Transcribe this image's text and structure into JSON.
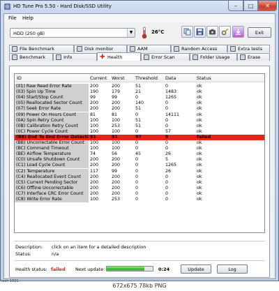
{
  "window": {
    "title": "HD Tune Pro 5.50 - Hard Disk/SSD Utility",
    "min_label": "–",
    "max_label": "□",
    "close_label": "✕"
  },
  "menu": {
    "file": "File",
    "help": "Help"
  },
  "toolbar": {
    "drive": "HDD         (250 gB)",
    "temperature": "26°C",
    "exit_label": "Exit",
    "icons": [
      "copy-icon",
      "save-icon",
      "camera-icon",
      "options-icon",
      "download-icon"
    ]
  },
  "tabs_top": [
    "File Benchmark",
    "Disk monitor",
    "AAM",
    "Random Access",
    "Extra tests"
  ],
  "tabs_bottom": [
    "Benchmark",
    "Info",
    "Health",
    "Error Scan",
    "Folder Usage",
    "Erase"
  ],
  "active_tab": "Health",
  "table": {
    "columns": [
      "ID",
      "Current",
      "Worst",
      "Threshold",
      "Data",
      "Status"
    ],
    "rows": [
      [
        "(01) Raw Read Error Rate",
        "200",
        "200",
        "51",
        "0",
        "ok"
      ],
      [
        "(03) Spin Up Time",
        "190",
        "179",
        "21",
        "1483",
        "ok"
      ],
      [
        "(04) Start/Stop Count",
        "99",
        "99",
        "0",
        "1265",
        "ok"
      ],
      [
        "(05) Reallocated Sector Count",
        "200",
        "200",
        "140",
        "0",
        "ok"
      ],
      [
        "(07) Seek Error Rate",
        "200",
        "200",
        "51",
        "0",
        "ok"
      ],
      [
        "(09) Power On Hours Count",
        "81",
        "81",
        "0",
        "14111",
        "ok"
      ],
      [
        "(0A) Spin Retry Count",
        "100",
        "100",
        "51",
        "0",
        "ok"
      ],
      [
        "(0B) Calibration Retry Count",
        "100",
        "253",
        "51",
        "0",
        "ok"
      ],
      [
        "(0C) Power Cycle Count",
        "100",
        "100",
        "0",
        "57",
        "ok"
      ],
      [
        "(B8) End To End Error Detecti...",
        "91",
        "91",
        "97",
        "9",
        "failed"
      ],
      [
        "(BB) Uncorrectable Error Count",
        "100",
        "100",
        "0",
        "0",
        "ok"
      ],
      [
        "(BC) Command Timeout",
        "100",
        "100",
        "0",
        "0",
        "ok"
      ],
      [
        "(BE) Airflow Temperature",
        "74",
        "56",
        "45",
        "26",
        "ok"
      ],
      [
        "(C0) Unsafe Shutdown Count",
        "200",
        "200",
        "0",
        "5",
        "ok"
      ],
      [
        "(C1) Load Cycle Count",
        "200",
        "200",
        "0",
        "1265",
        "ok"
      ],
      [
        "(C2) Temperature",
        "117",
        "99",
        "0",
        "26",
        "ok"
      ],
      [
        "(C4) Reallocated Event Count",
        "200",
        "200",
        "0",
        "0",
        "ok"
      ],
      [
        "(C5) Current Pending Sector",
        "200",
        "200",
        "0",
        "0",
        "ok"
      ],
      [
        "(C6) Offline Uncorrectable",
        "200",
        "200",
        "0",
        "0",
        "ok"
      ],
      [
        "(C7) Interface CRC Error Count",
        "200",
        "200",
        "0",
        "0",
        "ok"
      ],
      [
        "(C8) Write Error Rate",
        "100",
        "253",
        "0",
        "0",
        "ok"
      ]
    ],
    "failed_row_index": 9,
    "failed_color": "#e8231b"
  },
  "details": {
    "description_label": "Description:",
    "description_value": "click on an item for a detailed description",
    "status_label": "Status:",
    "status_value": "n/a"
  },
  "footer": {
    "health_label": "Health status:",
    "health_value": "failed",
    "next_update_label": "Next update:",
    "next_update_value": "0:24",
    "progress_fraction": 0.82,
    "update_label": "Update",
    "log_label": "Log"
  },
  "caption": {
    "text": "672x675 78kb PNG",
    "left_fragment": "iusn   1021"
  }
}
